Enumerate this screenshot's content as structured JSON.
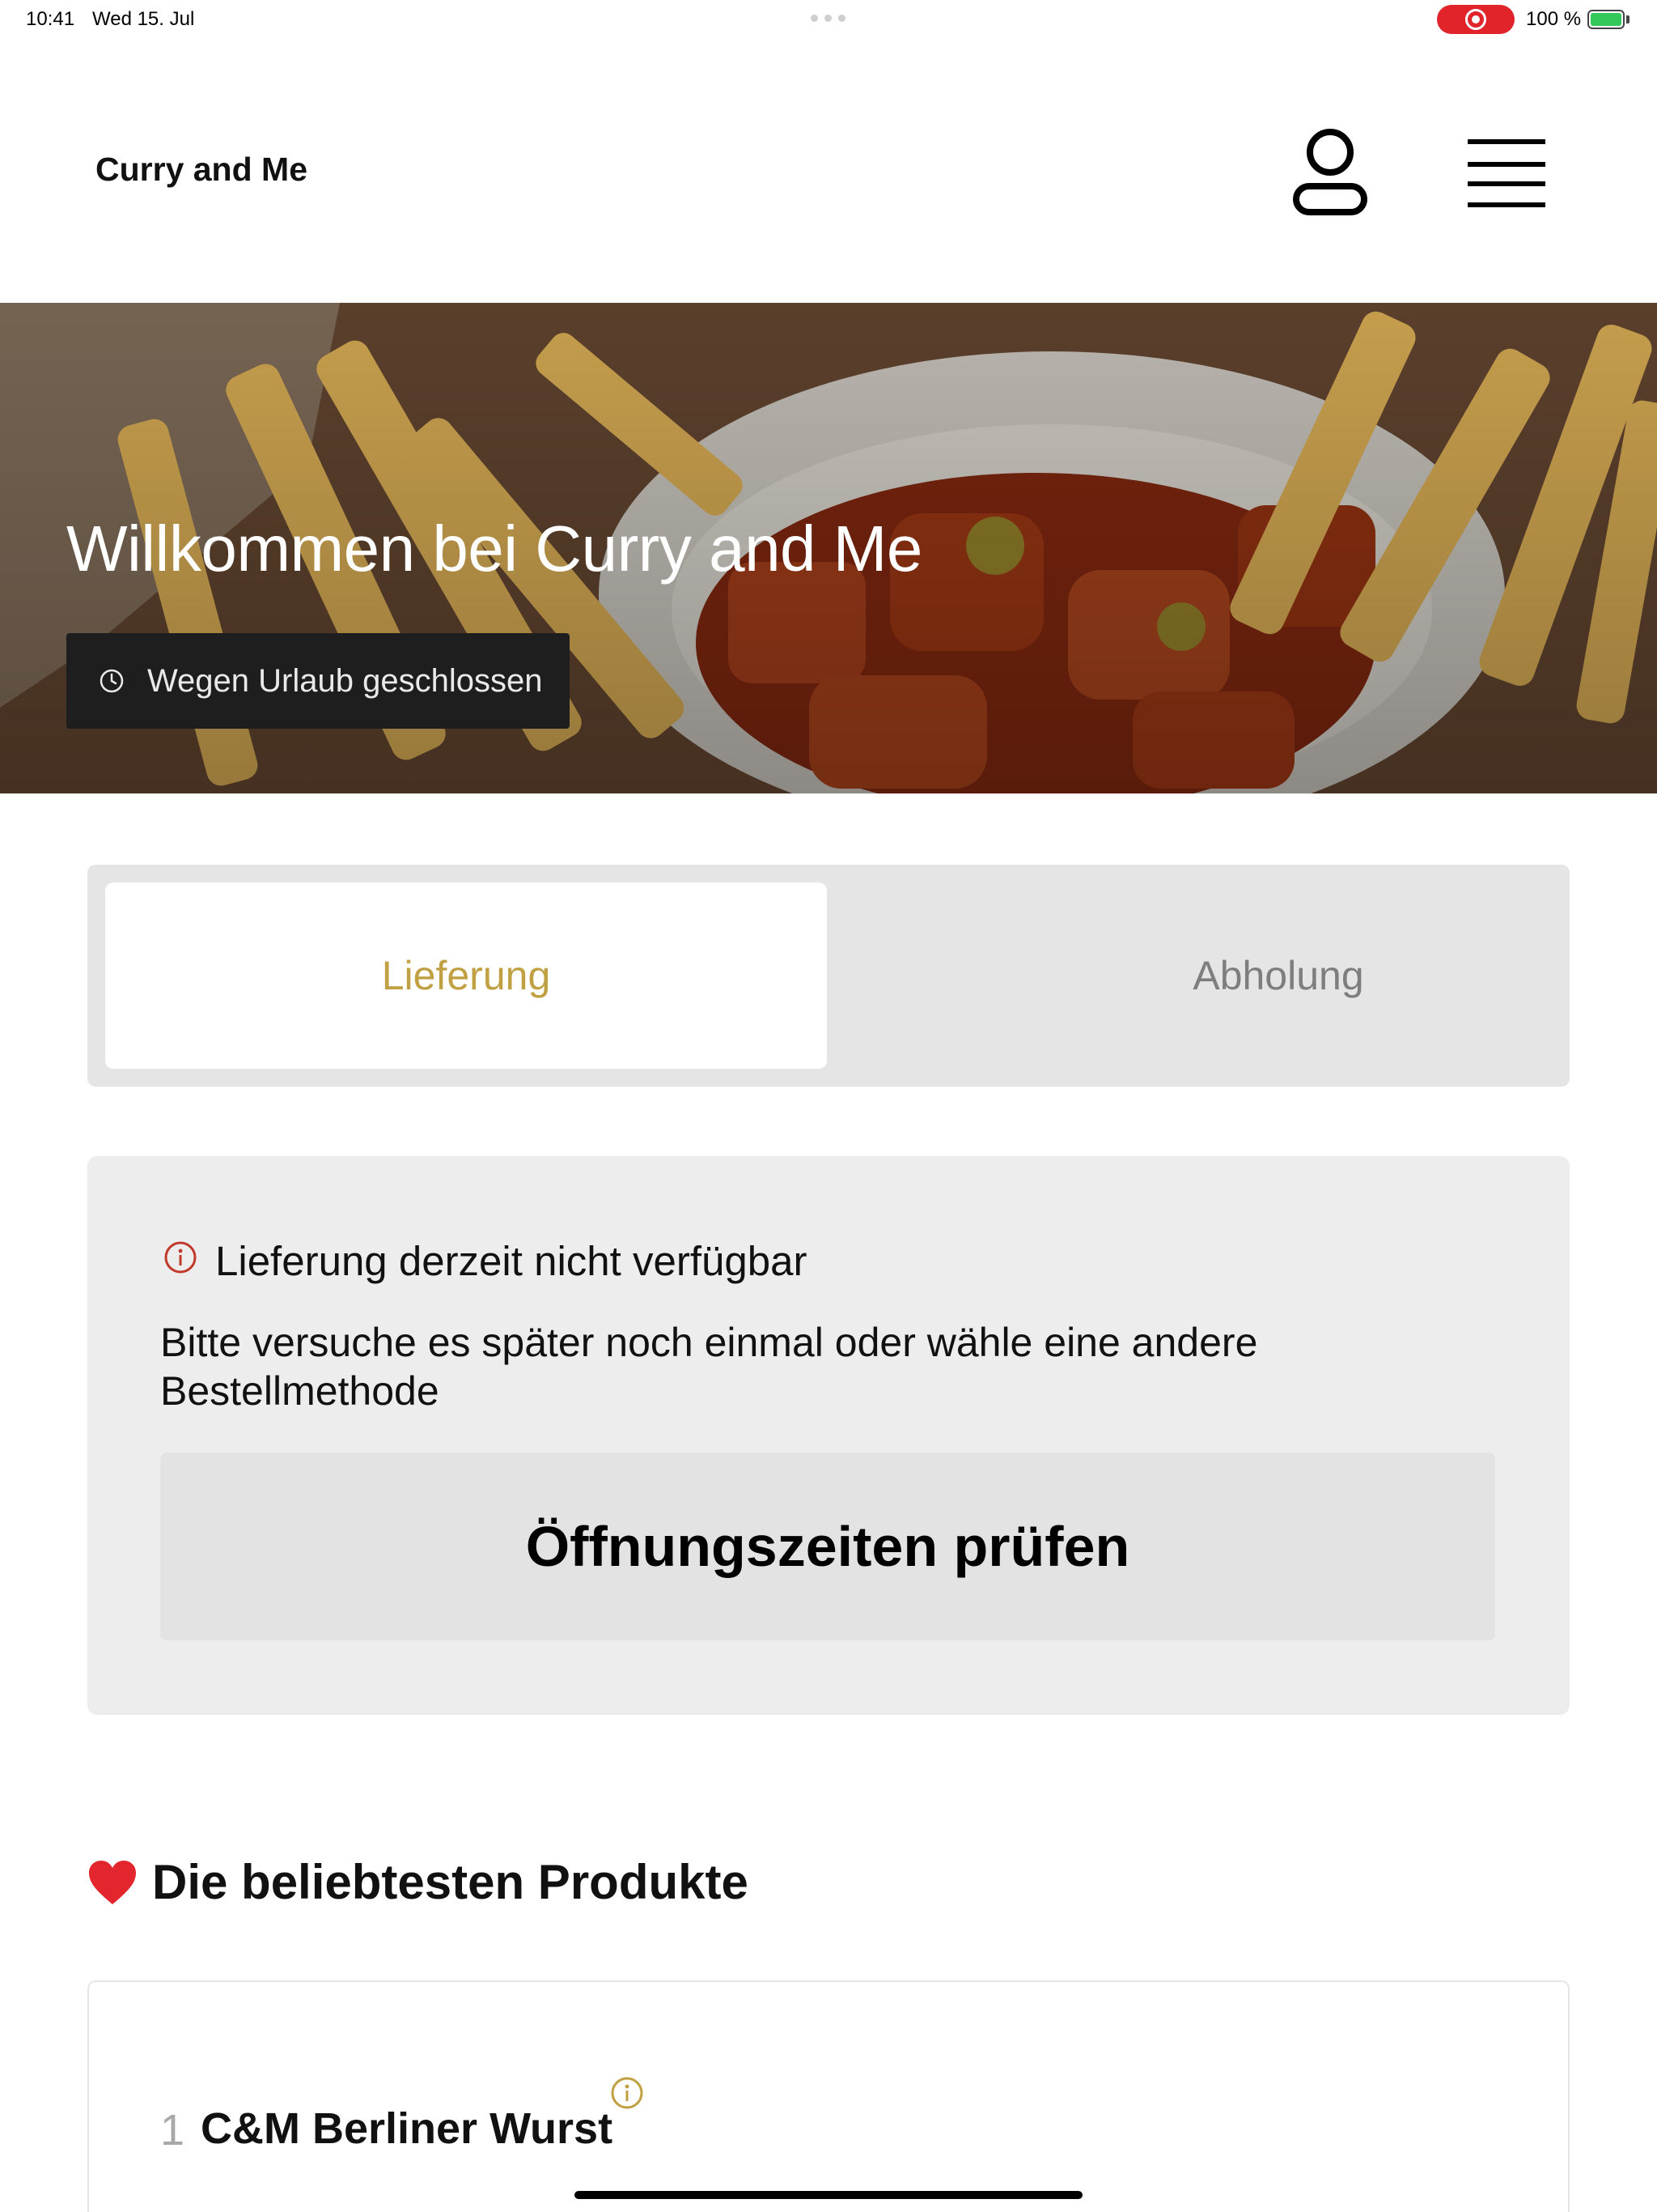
{
  "status_bar": {
    "time": "10:41",
    "date": "Wed 15. Jul",
    "battery": "100 %",
    "recording_color": "#e0242a"
  },
  "header": {
    "brand": "Curry and Me",
    "profile_icon": "person-icon",
    "menu_icon": "hamburger-menu-icon"
  },
  "hero": {
    "title": "Willkommen bei Curry and Me",
    "status_label": "Wegen Urlaub geschlossen",
    "status_icon": "clock-icon"
  },
  "order_method": {
    "options": [
      "Lieferung",
      "Abholung"
    ],
    "selected": "Lieferung",
    "accent_color": "#c0a042"
  },
  "notice": {
    "icon": "info-icon",
    "icon_color": "#c0392b",
    "title": "Lieferung derzeit nicht verfügbar",
    "body": "Bitte versuche es später noch einmal oder wähle eine andere Bestellmethode",
    "button": "Öffnungszeiten prüfen"
  },
  "popular": {
    "icon": "heart-icon",
    "title": "Die beliebtesten Produkte",
    "items": [
      {
        "rank": "1",
        "name": "C&M Berliner Wurst",
        "info_icon": "info-icon"
      }
    ]
  }
}
